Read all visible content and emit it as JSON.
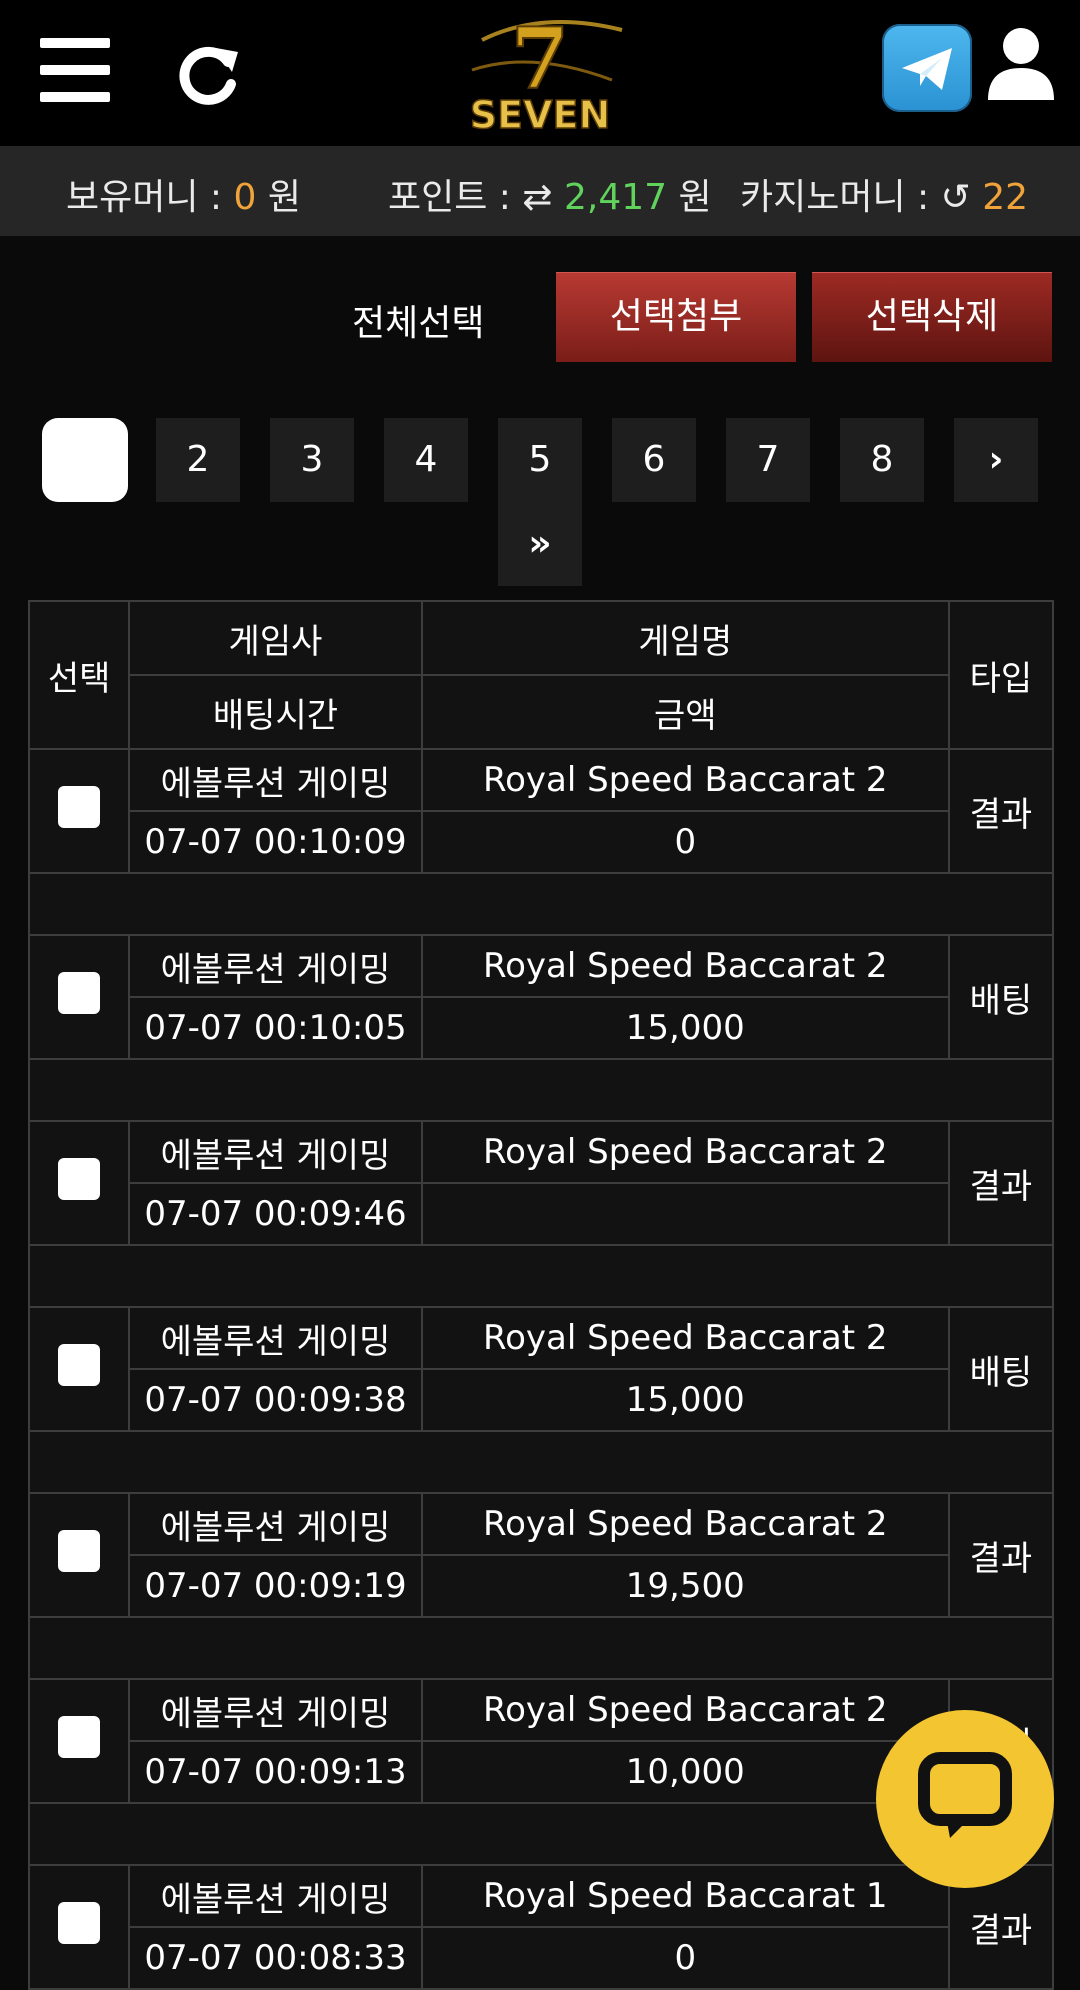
{
  "header": {
    "logo_text": "SEVEN",
    "logo_numeral": "7"
  },
  "balances": {
    "money_label": "보유머니 :",
    "money_value": "0",
    "money_unit": "원",
    "point_label": "포인트 :",
    "point_value": "2,417",
    "point_unit": "원",
    "casino_label": "카지노머니 :",
    "casino_value": "22"
  },
  "actions": {
    "select_all": "전체선택",
    "attach_selected": "선택첨부",
    "delete_selected": "선택삭제"
  },
  "pager": {
    "pages": [
      "2",
      "3",
      "4",
      "5",
      "6",
      "7",
      "8"
    ],
    "next": "›",
    "last": "»"
  },
  "table": {
    "headers": {
      "select": "선택",
      "vendor": "게임사",
      "game": "게임명",
      "type": "타입",
      "time": "배팅시간",
      "amount": "금액"
    },
    "rows": [
      {
        "vendor": "에볼루션 게이밍",
        "game": "Royal Speed Baccarat 2",
        "time": "07-07 00:10:09",
        "amount": "0",
        "type": "결과"
      },
      {
        "vendor": "에볼루션 게이밍",
        "game": "Royal Speed Baccarat 2",
        "time": "07-07 00:10:05",
        "amount": "15,000",
        "type": "배팅"
      },
      {
        "vendor": "에볼루션 게이밍",
        "game": "Royal Speed Baccarat 2",
        "time": "07-07 00:09:46",
        "amount": "",
        "type": "결과"
      },
      {
        "vendor": "에볼루션 게이밍",
        "game": "Royal Speed Baccarat 2",
        "time": "07-07 00:09:38",
        "amount": "15,000",
        "type": "배팅"
      },
      {
        "vendor": "에볼루션 게이밍",
        "game": "Royal Speed Baccarat 2",
        "time": "07-07 00:09:19",
        "amount": "19,500",
        "type": "결과"
      },
      {
        "vendor": "에볼루션 게이밍",
        "game": "Royal Speed Baccarat 2",
        "time": "07-07 00:09:13",
        "amount": "10,000",
        "type": "배팅"
      },
      {
        "vendor": "에볼루션 게이밍",
        "game": "Royal Speed Baccarat 1",
        "time": "07-07 00:08:33",
        "amount": "0",
        "type": "결과"
      }
    ]
  },
  "colors": {
    "positive": "#5fd35b",
    "bet": "#f0a33a",
    "button_red": "#9e2a24",
    "chat": "#f2c531"
  }
}
